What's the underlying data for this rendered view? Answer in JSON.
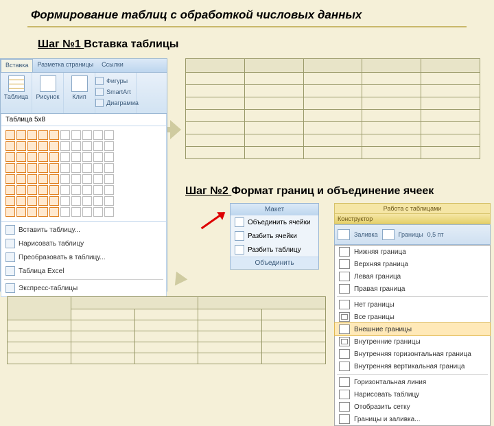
{
  "title": "Формирование таблиц с обработкой числовых данных",
  "step1": {
    "prefix": "Шаг №1 ",
    "text": "Вставка таблицы"
  },
  "step2": {
    "prefix": "Шаг №2 ",
    "text": "Формат границ и объединение ячеек"
  },
  "ribbon": {
    "tabs": [
      "Вставка",
      "Разметка страницы",
      "Ссылки"
    ],
    "buttons": {
      "tablica": "Таблица",
      "risunok": "Рисунок",
      "klip": "Клип",
      "figury": "Фигуры",
      "smartart": "SmartArt",
      "diagr": "Диаграмма"
    },
    "grid_label": "Таблица 5x8",
    "menu": {
      "insert": "Вставить таблицу...",
      "draw": "Нарисовать таблицу",
      "convert": "Преобразовать в таблицу...",
      "excel": "Таблица Excel",
      "express": "Экспресс-таблицы"
    }
  },
  "merge": {
    "header": "Макет",
    "items": {
      "merge": "Объединить ячейки",
      "split": "Разбить ячейки",
      "split_table": "Разбить таблицу"
    },
    "footer": "Объединить"
  },
  "rtools": {
    "title": "Работа с таблицами",
    "tab": "Конструктор",
    "bar": {
      "shading": "Заливка",
      "borders": "Границы",
      "pt": "0,5 пт"
    }
  },
  "borders": {
    "bottom": "Нижняя граница",
    "top": "Верхняя граница",
    "left": "Левая граница",
    "right": "Правая граница",
    "none": "Нет границы",
    "all": "Все границы",
    "outer": "Внешние границы",
    "inner": "Внутренние границы",
    "inner_h": "Внутренняя горизонтальная граница",
    "inner_v": "Внутренняя вертикальная граница",
    "hline": "Горизонтальная линия",
    "draw": "Нарисовать таблицу",
    "grid": "Отобразить сетку",
    "dialog": "Границы и заливка..."
  }
}
